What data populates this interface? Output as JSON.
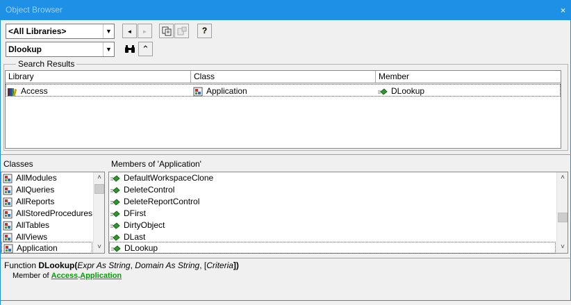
{
  "window": {
    "title": "Object Browser",
    "close_label": "×"
  },
  "toolbar": {
    "library_combo": "<All Libraries>",
    "search_combo": "Dlookup",
    "drop_arrow": "▼",
    "back_glyph": "◄",
    "forward_glyph": "►",
    "help_glyph": "?",
    "collapse_glyph": "⌃"
  },
  "search_results": {
    "group_label": "Search Results",
    "columns": [
      "Library",
      "Class",
      "Member"
    ],
    "rows": [
      {
        "library": "Access",
        "class": "Application",
        "member": "DLookup"
      }
    ]
  },
  "classes": {
    "label": "Classes",
    "items": [
      "AllModules",
      "AllQueries",
      "AllReports",
      "AllStoredProcedures",
      "AllTables",
      "AllViews",
      "Application"
    ],
    "selected": "Application"
  },
  "members": {
    "label": "Members of 'Application'",
    "items": [
      "DefaultWorkspaceClone",
      "DeleteControl",
      "DeleteReportControl",
      "DFirst",
      "DirtyObject",
      "DLast",
      "DLookup"
    ],
    "selected": "DLookup"
  },
  "details": {
    "prefix": "Function ",
    "name": "DLookup",
    "open_paren": "(",
    "arg1": "Expr As String",
    "sep1": ", ",
    "arg2": "Domain As String",
    "sep2": ", [",
    "arg3": "Criteria",
    "close": "])",
    "member_of_prefix": "Member of ",
    "member_of_library": "Access",
    "dot": ".",
    "member_of_class": "Application"
  },
  "scroll": {
    "up_glyph": "˄",
    "down_glyph": "˅"
  },
  "colors": {
    "titlebar": "#1e90e6",
    "link": "#00a000",
    "method_icon": "#2e9a2e"
  },
  "icons": {
    "library": "library-books-icon",
    "class": "class-module-icon",
    "method": "method-green-icon",
    "back": "back-arrow-icon",
    "forward": "forward-arrow-icon",
    "copy": "copy-icon",
    "view_definition": "view-definition-icon",
    "help": "help-icon",
    "search": "binoculars-icon",
    "collapse": "collapse-chevron-icon"
  }
}
